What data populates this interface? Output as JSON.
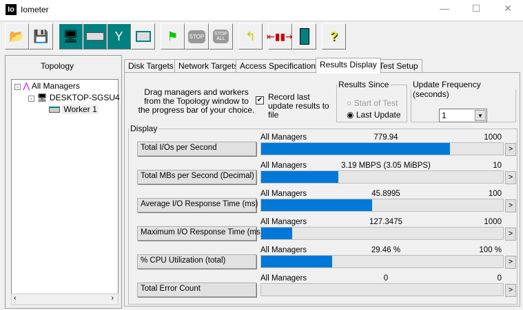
{
  "window": {
    "title": "Iometer",
    "icon_text": "Io"
  },
  "toolbar": {
    "buttons": [
      "open-icon",
      "save-icon",
      "start-display-icon",
      "new-worker-icon",
      "new-network-worker-icon",
      "duplicate-worker-icon",
      "start-icon",
      "stop-icon",
      "stop-all-icon",
      "reset-workers-icon",
      "disconnect-icon",
      "exit-icon",
      "help-icon"
    ]
  },
  "topology": {
    "title": "Topology",
    "nodes": [
      "All Managers",
      "DESKTOP-SGSU4",
      "Worker 1"
    ]
  },
  "tabs": [
    "Disk Targets",
    "Network Targets",
    "Access Specifications",
    "Results Display",
    "Test Setup"
  ],
  "active_tab": "Results Display",
  "instructions": "Drag managers and workers from the Topology window to the progress bar of your choice.",
  "record": {
    "label": "Record last update results to file",
    "checked": true
  },
  "results_since": {
    "title": "Results Since",
    "options": [
      "Start of Test",
      "Last Update"
    ],
    "selected": "Last Update"
  },
  "update_frequency": {
    "title": "Update Frequency (seconds)",
    "value": "1"
  },
  "display": {
    "title": "Display",
    "rows": [
      {
        "button": "Total I/Os per Second",
        "source": "All Managers",
        "value": "779.94",
        "max": "1000",
        "fraction": 0.7799
      },
      {
        "button": "Total MBs per Second (Decimal)",
        "source": "All Managers",
        "value": "3.19 MBPS (3.05 MiBPS)",
        "max": "10",
        "fraction": 0.319
      },
      {
        "button": "Average I/O Response Time (ms)",
        "source": "All Managers",
        "value": "45.8995",
        "max": "100",
        "fraction": 0.459
      },
      {
        "button": "Maximum I/O Response Time (ms)",
        "source": "All Managers",
        "value": "127.3475",
        "max": "1000",
        "fraction": 0.127
      },
      {
        "button": "% CPU Utilization (total)",
        "source": "All Managers",
        "value": "29.46 %",
        "max": "100 %",
        "fraction": 0.2946
      },
      {
        "button": "Total Error Count",
        "source": "All Managers",
        "value": "0",
        "max": "0",
        "fraction": 0
      }
    ],
    "arrow": ">"
  },
  "colors": {
    "bar": "#0078d7"
  }
}
